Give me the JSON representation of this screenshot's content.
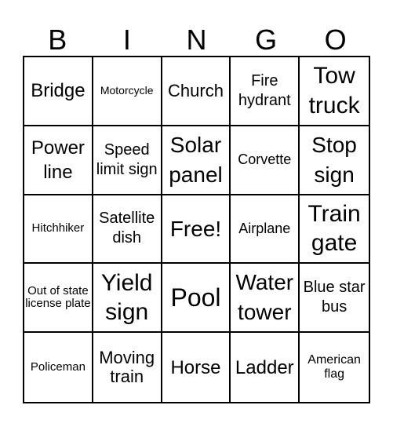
{
  "header": [
    "B",
    "I",
    "N",
    "G",
    "O"
  ],
  "cells": [
    "Bridge",
    "Motorcycle",
    "Church",
    "Fire hydrant",
    "Tow truck",
    "Power line",
    "Speed limit sign",
    "Solar panel",
    "Corvette",
    "Stop sign",
    "Hitchhiker",
    "Satellite dish",
    "Free!",
    "Airplane",
    "Train gate",
    "Out of state license plate",
    "Yield sign",
    "Pool",
    "Water tower",
    "Blue star bus",
    "Policeman",
    "Moving train",
    "Horse",
    "Ladder",
    "American flag"
  ]
}
